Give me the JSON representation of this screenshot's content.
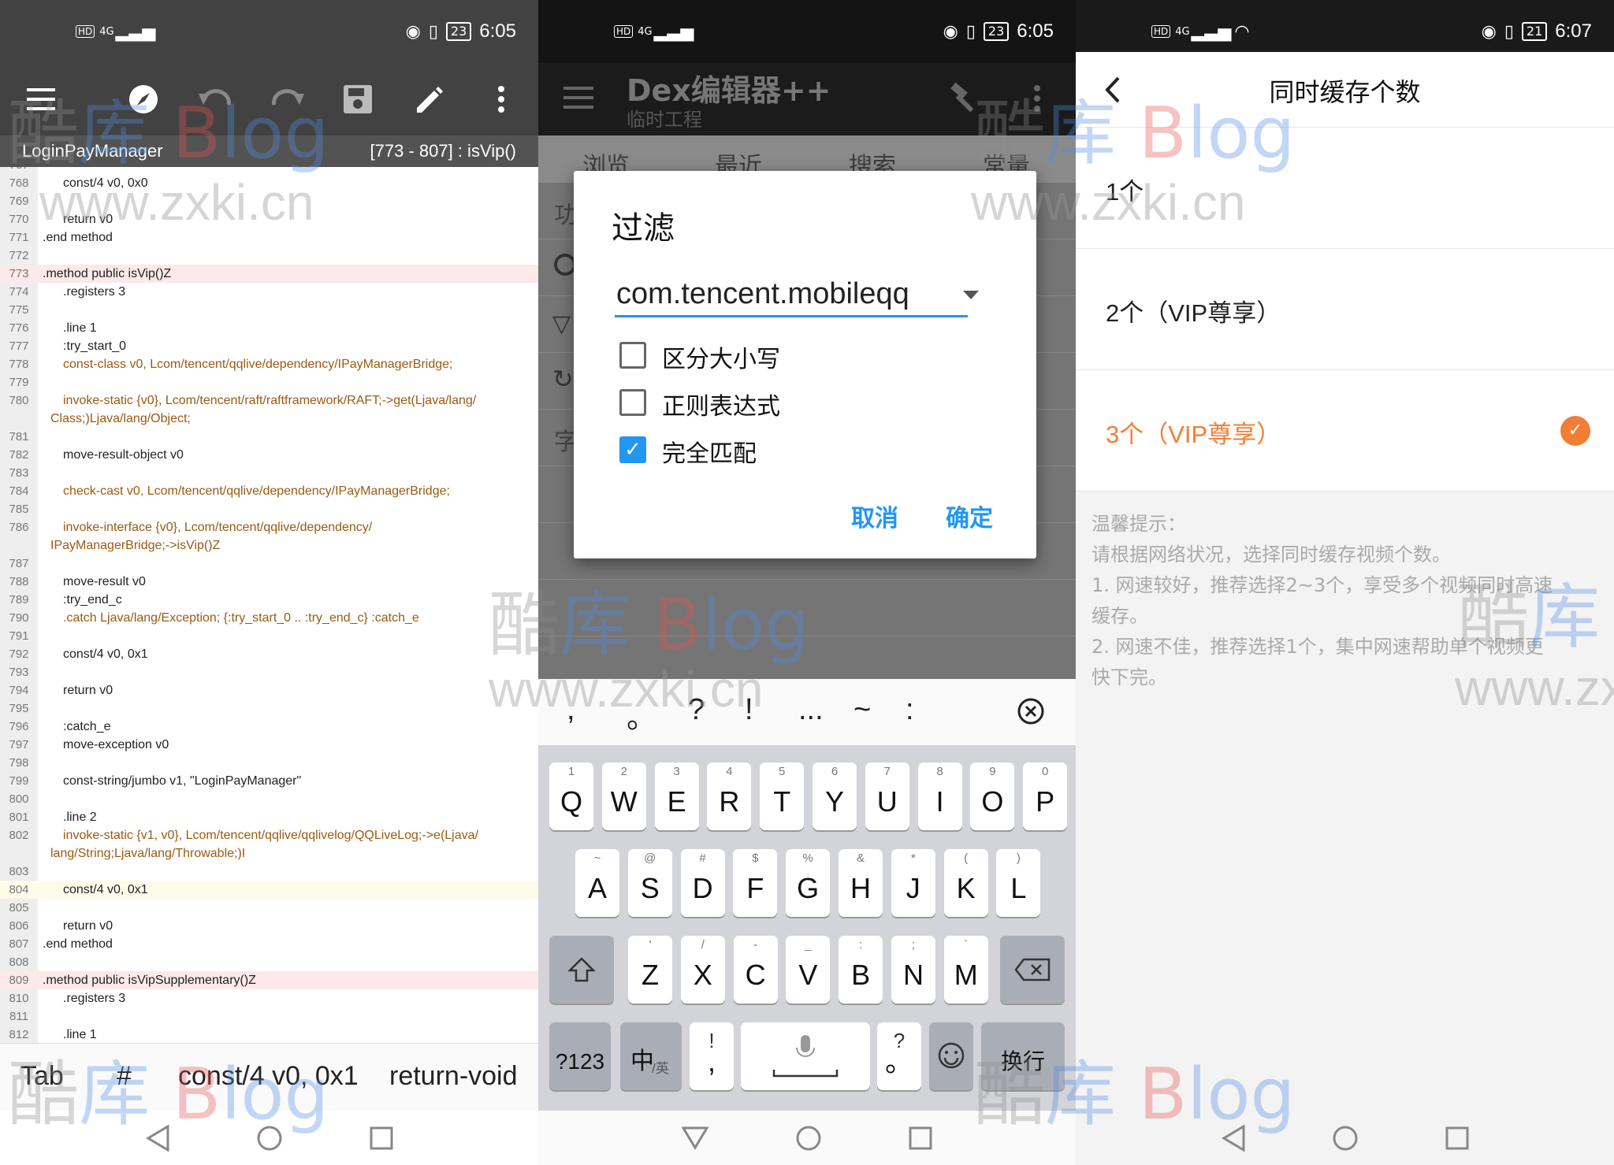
{
  "status_bars": [
    {
      "time": "6:05",
      "battery": "23",
      "network": "4G"
    },
    {
      "time": "6:05",
      "battery": "23",
      "network": "4G"
    },
    {
      "time": "6:07",
      "battery": "21",
      "network": "4G"
    }
  ],
  "editor": {
    "class_name": "LoginPayManager",
    "range_info": "[773 - 807] : isVip()",
    "lines": [
      {
        "n": "767",
        "t": ""
      },
      {
        "n": "768",
        "t": "const/4 v0, 0x0"
      },
      {
        "n": "769",
        "t": ""
      },
      {
        "n": "770",
        "t": "return v0"
      },
      {
        "n": "771",
        "t": ".end method"
      },
      {
        "n": "772",
        "t": ""
      },
      {
        "n": "773",
        "t": ".method public isVip()Z"
      },
      {
        "n": "774",
        "t": ".registers 3"
      },
      {
        "n": "775",
        "t": ""
      },
      {
        "n": "776",
        "t": ".line 1"
      },
      {
        "n": "777",
        "t": ":try_start_0"
      },
      {
        "n": "778",
        "t": "const-class v0, Lcom/tencent/qqlive/dependency/IPayManagerBridge;"
      },
      {
        "n": "779",
        "t": ""
      },
      {
        "n": "780",
        "t": "invoke-static {v0}, Lcom/tencent/raft/raftframework/RAFT;->get(Ljava/lang/"
      },
      {
        "n": "",
        "t": "Class;)Ljava/lang/Object;"
      },
      {
        "n": "781",
        "t": ""
      },
      {
        "n": "782",
        "t": "move-result-object v0"
      },
      {
        "n": "783",
        "t": ""
      },
      {
        "n": "784",
        "t": "check-cast v0, Lcom/tencent/qqlive/dependency/IPayManagerBridge;"
      },
      {
        "n": "785",
        "t": ""
      },
      {
        "n": "786",
        "t": "invoke-interface {v0}, Lcom/tencent/qqlive/dependency/"
      },
      {
        "n": "",
        "t": "IPayManagerBridge;->isVip()Z"
      },
      {
        "n": "787",
        "t": ""
      },
      {
        "n": "788",
        "t": "move-result v0"
      },
      {
        "n": "789",
        "t": ":try_end_c"
      },
      {
        "n": "790",
        "t": ".catch Ljava/lang/Exception; {:try_start_0 .. :try_end_c} :catch_e"
      },
      {
        "n": "791",
        "t": ""
      },
      {
        "n": "792",
        "t": "const/4 v0, 0x1"
      },
      {
        "n": "793",
        "t": ""
      },
      {
        "n": "794",
        "t": "return v0"
      },
      {
        "n": "795",
        "t": ""
      },
      {
        "n": "796",
        "t": ":catch_e"
      },
      {
        "n": "797",
        "t": "move-exception v0"
      },
      {
        "n": "798",
        "t": ""
      },
      {
        "n": "799",
        "t": "const-string/jumbo v1, \"LoginPayManager\""
      },
      {
        "n": "800",
        "t": ""
      },
      {
        "n": "801",
        "t": ".line 2"
      },
      {
        "n": "802",
        "t": "invoke-static {v1, v0}, Lcom/tencent/qqlive/qqlivelog/QQLiveLog;->e(Ljava/"
      },
      {
        "n": "",
        "t": "lang/String;Ljava/lang/Throwable;)I"
      },
      {
        "n": "803",
        "t": ""
      },
      {
        "n": "804",
        "t": "const/4 v0, 0x1"
      },
      {
        "n": "805",
        "t": ""
      },
      {
        "n": "806",
        "t": "return v0"
      },
      {
        "n": "807",
        "t": ".end method"
      },
      {
        "n": "808",
        "t": ""
      },
      {
        "n": "809",
        "t": ".method public isVipSupplementary()Z"
      },
      {
        "n": "810",
        "t": ".registers 3"
      },
      {
        "n": "811",
        "t": ""
      },
      {
        "n": "812",
        "t": ".line 1"
      }
    ],
    "accessory": [
      "Tab",
      "#",
      "const/4 v0, 0x1",
      "return-void"
    ]
  },
  "dex": {
    "app_title": "Dex编辑器++",
    "project": "临时工程",
    "tabs": [
      "浏览",
      "最近",
      "搜索",
      "常量"
    ],
    "side_chars": [
      "功",
      "字"
    ],
    "dialog": {
      "title": "过滤",
      "input_value": "com.tencent.mobileqq",
      "checkboxes": [
        {
          "label": "区分大小写",
          "checked": false
        },
        {
          "label": "正则表达式",
          "checked": false
        },
        {
          "label": "完全匹配",
          "checked": true
        }
      ],
      "cancel": "取消",
      "ok": "确定"
    },
    "keyboard": {
      "suggestions": [
        ",",
        "。",
        "?",
        "!",
        "...",
        "~",
        ":"
      ],
      "row1": [
        [
          "Q",
          "1"
        ],
        [
          "W",
          "2"
        ],
        [
          "E",
          "3"
        ],
        [
          "R",
          "4"
        ],
        [
          "T",
          "5"
        ],
        [
          "Y",
          "6"
        ],
        [
          "U",
          "7"
        ],
        [
          "I",
          "8"
        ],
        [
          "O",
          "9"
        ],
        [
          "P",
          "0"
        ]
      ],
      "row2": [
        [
          "A",
          "~"
        ],
        [
          "S",
          "@"
        ],
        [
          "D",
          "#"
        ],
        [
          "F",
          "$"
        ],
        [
          "G",
          "%"
        ],
        [
          "H",
          "&"
        ],
        [
          "J",
          "*"
        ],
        [
          "K",
          "("
        ],
        [
          "L",
          ")"
        ]
      ],
      "row3": [
        [
          "Z",
          "'"
        ],
        [
          "X",
          "/"
        ],
        [
          "C",
          "-"
        ],
        [
          "V",
          "_"
        ],
        [
          "B",
          ":"
        ],
        [
          "N",
          ";"
        ],
        [
          "M",
          "`"
        ]
      ],
      "num_key": "?123",
      "lang_key": "中",
      "lang_sub": "/英",
      "punct_top": "!",
      "punct_bottom": ",",
      "punct2_top": "?",
      "punct2_bottom": "。",
      "enter": "换行"
    }
  },
  "cache": {
    "title": "同时缓存个数",
    "options": [
      {
        "label": "1个",
        "selected": false
      },
      {
        "label": "2个（VIP尊享）",
        "selected": false
      },
      {
        "label": "3个（VIP尊享）",
        "selected": true
      }
    ],
    "tips_title": "温馨提示：",
    "tips": [
      "请根据网络状况，选择同时缓存视频个数。",
      "1. 网速较好，推荐选择2~3个，享受多个视频同时高速",
      "缓存。",
      "2. 网速不佳，推荐选择1个，集中网速帮助单个视频更",
      "快下完。"
    ]
  },
  "watermark": {
    "cn": [
      "酷",
      "库",
      "B",
      "log"
    ],
    "url": "www.zxki.cn"
  },
  "colors": {
    "accent_blue": "#2196f3",
    "accent_orange": "#f27e35"
  }
}
